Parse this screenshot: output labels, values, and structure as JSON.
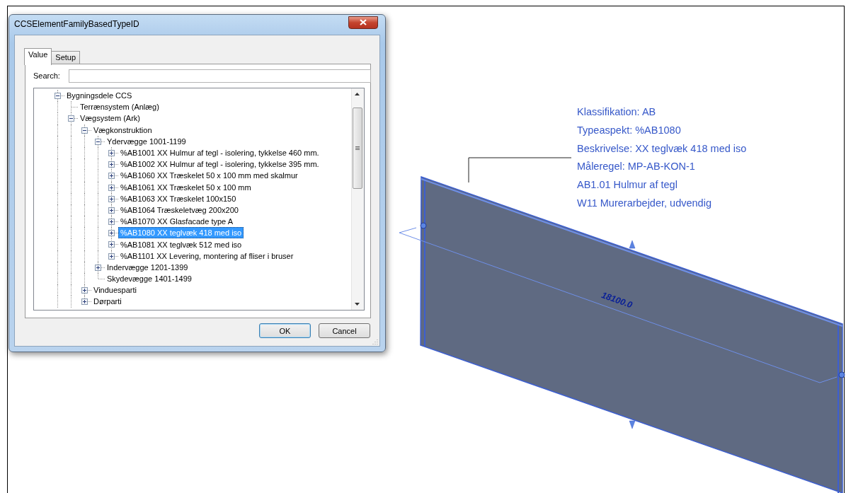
{
  "dialog": {
    "title": "CCSElementFamilyBasedTypeID",
    "tabs": [
      {
        "label": "Value",
        "selected": true
      },
      {
        "label": "Setup",
        "selected": false
      }
    ],
    "search": {
      "label": "Search:"
    },
    "tree": [
      {
        "label": "Bygningsdele CCS",
        "expanded": true,
        "selected": false,
        "children": [
          {
            "label": "Terrænsystem (Anlæg)",
            "selected": false
          },
          {
            "label": "Vægsystem (Ark)",
            "expanded": true,
            "selected": false,
            "children": [
              {
                "label": "Vægkonstruktion",
                "expanded": true,
                "selected": false,
                "children": [
                  {
                    "label": "Ydervægge 1001-1199",
                    "expanded": true,
                    "selected": false,
                    "children": [
                      {
                        "label": "%AB1001 XX Hulmur af tegl - isolering, tykkelse 460 mm.",
                        "expanded": false,
                        "selected": false
                      },
                      {
                        "label": "%AB1002 XX Hulmur af tegl - isolering, tykkelse 395  mm.",
                        "expanded": false,
                        "selected": false
                      },
                      {
                        "label": "%AB1060 XX Træskelet 50 x 100 mm med skalmur",
                        "expanded": false,
                        "selected": false
                      },
                      {
                        "label": "%AB1061 XX Træskelet 50 x 100 mm",
                        "expanded": false,
                        "selected": false
                      },
                      {
                        "label": "%AB1063 XX Træskelet 100x150",
                        "expanded": false,
                        "selected": false
                      },
                      {
                        "label": "%AB1064 Træskeletvæg 200x200",
                        "expanded": false,
                        "selected": false
                      },
                      {
                        "label": "%AB1070 XX Glasfacade type A",
                        "expanded": false,
                        "selected": false
                      },
                      {
                        "label": "%AB1080 XX teglvæk 418 med iso",
                        "expanded": false,
                        "selected": true
                      },
                      {
                        "label": "%AB1081 XX teglvæk 512 med iso",
                        "expanded": false,
                        "selected": false
                      },
                      {
                        "label": "%AB1101 XX Levering, montering af fliser i bruser",
                        "expanded": false,
                        "selected": false
                      }
                    ]
                  },
                  {
                    "label": "Indervægge 1201-1399",
                    "expanded": false,
                    "selected": false
                  },
                  {
                    "label": "Skydevægge 1401-1499",
                    "selected": false
                  }
                ]
              },
              {
                "label": "Vinduesparti",
                "expanded": false,
                "selected": false
              },
              {
                "label": "Dørparti",
                "expanded": false,
                "selected": false
              }
            ]
          }
        ]
      }
    ],
    "buttons": [
      {
        "label": "OK",
        "default": true
      },
      {
        "label": "Cancel",
        "default": false
      }
    ]
  },
  "canvas": {
    "tag_lines": [
      "Klassifikation: AB",
      "Typeaspekt: %AB1080",
      "Beskrivelse: XX teglvæk 418 med iso",
      "Måleregel: MP-AB-KON-1",
      "AB1.01 Hulmur af tegl",
      "W11 Murerarbejder, udvendig"
    ],
    "dimension": "18100.0"
  }
}
